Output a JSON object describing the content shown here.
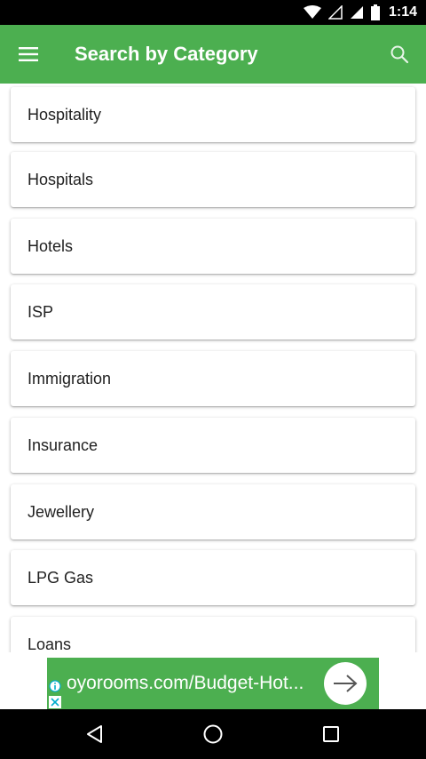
{
  "status_bar": {
    "time": "1:14"
  },
  "app_bar": {
    "title": "Search by Category",
    "menu_icon": "hamburger-menu-icon",
    "search_icon": "search-icon",
    "color": "#4caf50"
  },
  "categories": [
    "Hospitality",
    "Hospitals",
    "Hotels",
    "ISP",
    "Immigration",
    "Insurance",
    "Jewellery",
    "LPG Gas",
    "Loans"
  ],
  "ad": {
    "text": "oyorooms.com/Budget-Hot...",
    "arrow_icon": "arrow-right-icon",
    "info_icon": "info-icon",
    "close_icon": "close-icon"
  },
  "nav_bar": {
    "back_icon": "back-icon",
    "home_icon": "home-icon",
    "recents_icon": "recents-icon"
  }
}
